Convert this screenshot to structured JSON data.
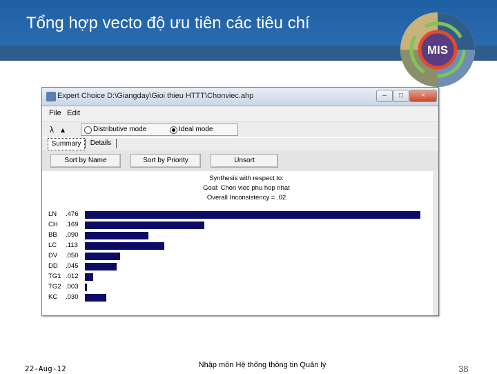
{
  "slide": {
    "title": "Tổng hợp vecto độ ưu tiên các tiêu chí",
    "logo_text": "MIS",
    "footer_date": "22-Aug-12",
    "footer_course": "Nhập môn Hệ thống thông tin Quản lý",
    "page_number": "38"
  },
  "window": {
    "title": "Expert Choice   D:\\Giangday\\Gioi thieu HTTT\\Chonviec.ahp",
    "minimize": "–",
    "maximize": "□",
    "close": "×"
  },
  "menu": {
    "file": "File",
    "edit": "Edit"
  },
  "toolbar": {
    "mode_distributive": "Distributive mode",
    "mode_ideal": "Ideal mode",
    "selected_mode": "Ideal mode"
  },
  "tabs": {
    "summary": "Summary",
    "details": "Details",
    "active": "Summary"
  },
  "buttons": {
    "sort_name": "Sort by Name",
    "sort_priority": "Sort by Priority",
    "unsort": "Unsort"
  },
  "synthesis": {
    "line1": "Synthesis with respect to:",
    "line2": "Goal: Chon viec phu hop nhat",
    "line3": "Overall Inconsistency = .02"
  },
  "colors": {
    "bar": "#0c0c66",
    "title_bg": "#2b6cb0"
  },
  "chart_data": {
    "type": "bar",
    "orientation": "horizontal",
    "categories": [
      "LN",
      "CH",
      "BB",
      "LC",
      "DV",
      "DD",
      "TG1",
      "TG2",
      "KC"
    ],
    "value_labels": [
      ".476",
      ".169",
      ".090",
      ".113",
      ".050",
      ".045",
      ".012",
      ".003",
      ".030"
    ],
    "values": [
      0.476,
      0.169,
      0.09,
      0.113,
      0.05,
      0.045,
      0.012,
      0.003,
      0.03
    ],
    "xlim": [
      0,
      0.476
    ]
  }
}
